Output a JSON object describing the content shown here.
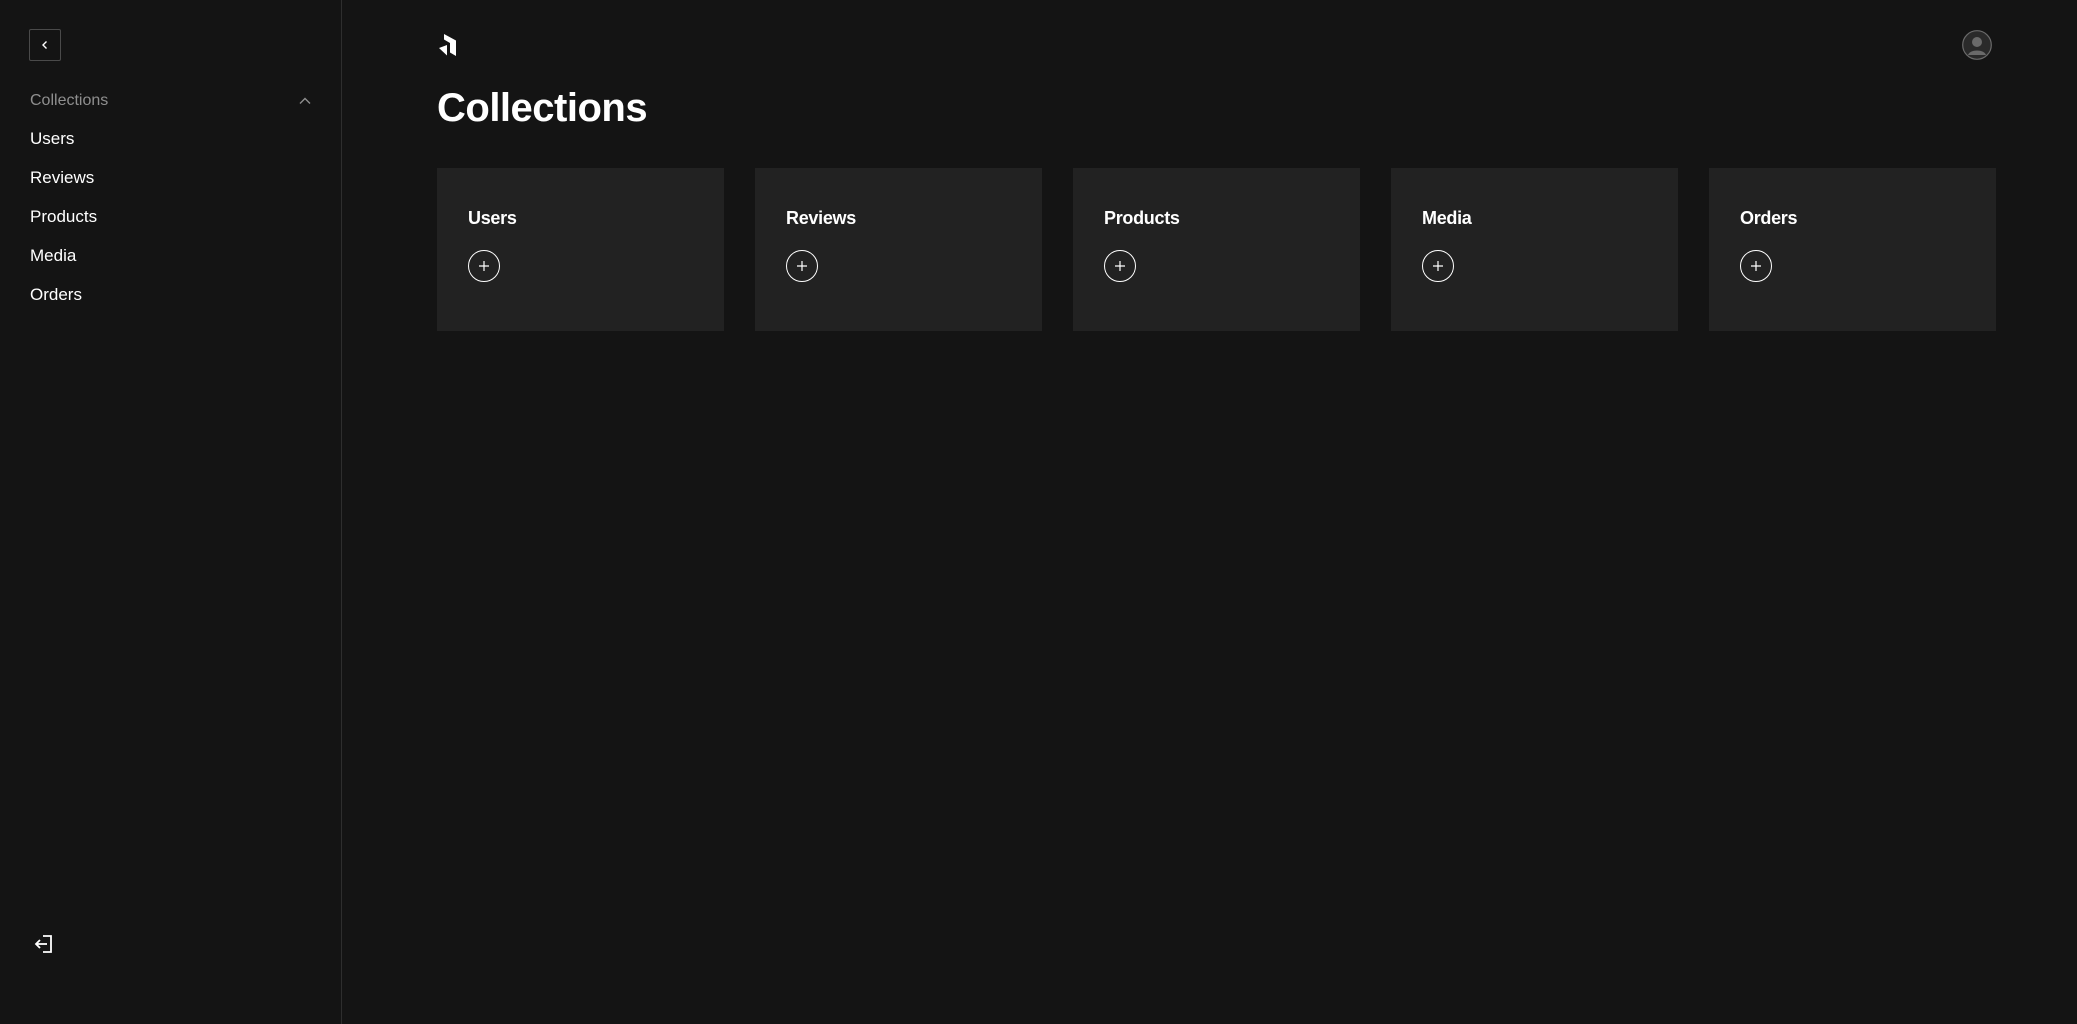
{
  "sidebar": {
    "collapse_icon": "chevron-left-icon",
    "group": {
      "label": "Collections",
      "toggle_icon": "chevron-up-icon"
    },
    "items": [
      {
        "label": "Users"
      },
      {
        "label": "Reviews"
      },
      {
        "label": "Products"
      },
      {
        "label": "Media"
      },
      {
        "label": "Orders"
      }
    ],
    "logout_icon": "logout-icon"
  },
  "header": {
    "logo_icon": "payload-logo-icon",
    "avatar_icon": "user-avatar-icon"
  },
  "main": {
    "title": "Collections",
    "cards": [
      {
        "title": "Users",
        "add_icon": "plus-circle-icon"
      },
      {
        "title": "Reviews",
        "add_icon": "plus-circle-icon"
      },
      {
        "title": "Products",
        "add_icon": "plus-circle-icon"
      },
      {
        "title": "Media",
        "add_icon": "plus-circle-icon"
      },
      {
        "title": "Orders",
        "add_icon": "plus-circle-icon"
      }
    ]
  },
  "colors": {
    "background": "#141414",
    "card": "#222222",
    "border": "#2e2e2e",
    "muted_text": "#8f8f8f",
    "text": "#ffffff"
  }
}
